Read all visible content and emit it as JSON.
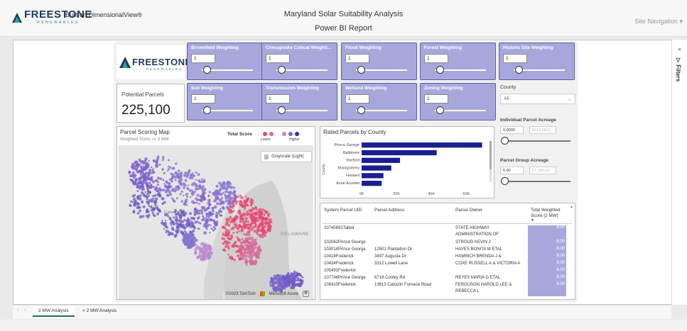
{
  "header": {
    "brand": "FREESTONE",
    "brand_sub": "RENEWABLES",
    "built_on": "Built on DimensionalView®",
    "title": "Maryland Solar Suitability Analysis",
    "subtitle": "Power BI Report",
    "site_nav": "Site Navigation"
  },
  "filters_pane": {
    "label": "Filters"
  },
  "weightings": [
    {
      "label": "Brownfield Weighting",
      "value": "1"
    },
    {
      "label": "Chesapeake Critical Weighti...",
      "value": "1"
    },
    {
      "label": "Flood Weighting",
      "value": "1"
    },
    {
      "label": "Forest Weighting",
      "value": "1"
    },
    {
      "label": "Historic Site Weighting",
      "value": "1"
    },
    {
      "label": "Soil Weighting",
      "value": "1"
    },
    {
      "label": "Transmission Weighting",
      "value": "1"
    },
    {
      "label": "Wetland Weighting",
      "value": "1"
    },
    {
      "label": "Zoning Weighting",
      "value": "1"
    }
  ],
  "potential_parcels": {
    "label": "Potential Parcels",
    "value": "225,100"
  },
  "county_filter": {
    "label": "County",
    "value": "All"
  },
  "individual_acreage": {
    "label": "Individual Parcel Acreage",
    "min": "0.0000",
    "max": "4210.0813"
  },
  "group_acreage": {
    "label": "Parcel Group Acreage",
    "min": "5.00",
    "max": "27,995.00"
  },
  "map": {
    "title": "Parcel Scoring Map",
    "subtitle": "Weighted Score <= 2 MW",
    "legend_title": "Total Score",
    "legend_low": "Lower",
    "legend_high": "Higher",
    "legend_colors": [
      "#e8456f",
      "#d36a9a",
      "#b98ad0",
      "#7a63c8",
      "#2b2f9a"
    ],
    "basemap_button": "Grayscale (Light)",
    "label_delaware": "DELAWARE",
    "label_columbia": "Columbia",
    "copyright": "©2023 TomTom",
    "provider": "Microsoft Azure"
  },
  "bar_chart": {
    "title": "Rated Parcels by County",
    "ylabel": "County"
  },
  "chart_data": {
    "type": "bar",
    "title": "Rated Parcels by County",
    "xlabel": "",
    "ylabel": "County",
    "categories": [
      "Prince George",
      "Baltimore",
      "Harford",
      "Montgomery",
      "Howard",
      "Anne Arundel"
    ],
    "values": [
      69000,
      43000,
      22000,
      17000,
      12500,
      11500
    ],
    "xlim": [
      0,
      70000
    ],
    "xticks": [
      "0K",
      "20K",
      "40K",
      "60K"
    ],
    "color": "#1a1f8f"
  },
  "table": {
    "headers": [
      "System Parcel UID",
      "Parcel Address",
      "Parcel Owner",
      "Total Weighted Score (2 MW)"
    ],
    "rows": [
      {
        "uid": "20740891Talbot",
        "address": "",
        "owner": "STATE HIGHWAY",
        "owner2": "ADMINISTRATION OF",
        "score": "9.00"
      },
      {
        "uid": "102062Prince George",
        "address": "",
        "owner": "STROUD KEVIN J",
        "owner2": "",
        "score": "8.00"
      },
      {
        "uid": "103014Prince George",
        "address": "12501 Plantation Dr",
        "owner": "HAYES BONITA M ETAL",
        "owner2": "",
        "score": "8.00"
      },
      {
        "uid": "10418Frederick",
        "address": "3497 Augusta Dr",
        "owner": "HAMRICH BRENDA J &",
        "owner2": "",
        "score": "8.00"
      },
      {
        "uid": "10434Frederick",
        "address": "3312 Lowell Lane",
        "owner": "COXE RUSSELL A & VICTORIA A",
        "owner2": "",
        "score": "8.00"
      },
      {
        "uid": "105491Frederick",
        "address": "",
        "owner": "",
        "owner2": "",
        "score": "8.00"
      },
      {
        "uid": "107746Prince George",
        "address": "6719 Conley Rd",
        "owner": "REYES MARIA G ETAL",
        "owner2": "",
        "score": "8.00"
      },
      {
        "uid": "108410Frederick",
        "address": "13613 Catoctin Furnace Road",
        "owner": "FERGUSON HAROLD LEE &",
        "owner2": "REBECCA L",
        "score": "8.00"
      }
    ]
  },
  "tabs": [
    {
      "label": "2 MW Analysis",
      "active": true
    },
    {
      "label": "> 2 MW Analysis",
      "active": false
    }
  ]
}
